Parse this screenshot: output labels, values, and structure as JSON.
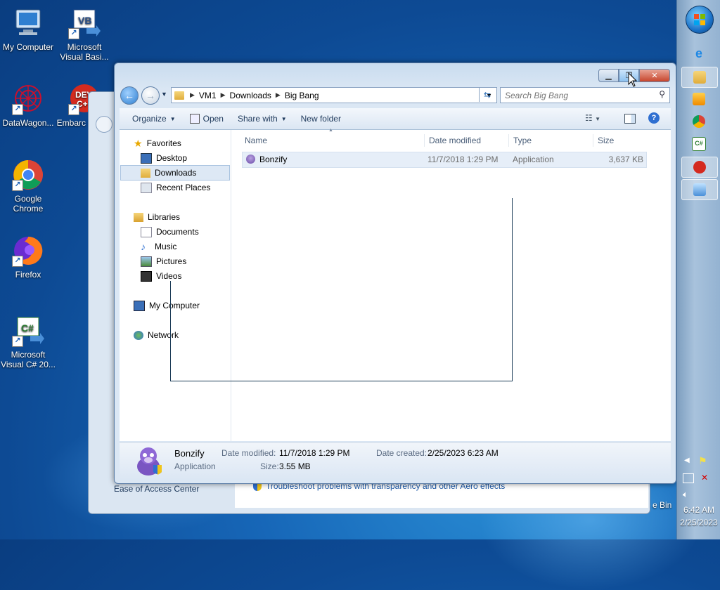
{
  "desktop": {
    "icons": [
      {
        "label": "My Computer"
      },
      {
        "label": "Microsoft Visual Basi..."
      },
      {
        "label": "DataWagon..."
      },
      {
        "label": "Embarc Dev-C"
      },
      {
        "label": "Google Chrome"
      },
      {
        "label": "Firefox"
      },
      {
        "label": "Microsoft Visual C# 20..."
      }
    ],
    "recycle_bin_partial": "e Bin"
  },
  "background_window": {
    "left_text": "Ease of Access Center",
    "link_text": "Troubleshoot problems with transparency and other Aero effects"
  },
  "explorer": {
    "address": {
      "crumbs": [
        "VM1",
        "Downloads",
        "Big Bang"
      ]
    },
    "search": {
      "placeholder": "Search Big Bang"
    },
    "toolbar": {
      "organize": "Organize",
      "open": "Open",
      "share_with": "Share with",
      "new_folder": "New folder"
    },
    "nav": {
      "favorites": "Favorites",
      "desktop": "Desktop",
      "downloads": "Downloads",
      "recent_places": "Recent Places",
      "libraries": "Libraries",
      "documents": "Documents",
      "music": "Music",
      "pictures": "Pictures",
      "videos": "Videos",
      "my_computer": "My Computer",
      "network": "Network"
    },
    "columns": {
      "name": "Name",
      "date_modified": "Date modified",
      "type": "Type",
      "size": "Size"
    },
    "files": [
      {
        "name": "Bonzify",
        "date_modified": "11/7/2018 1:29 PM",
        "type": "Application",
        "size": "3,637 KB"
      }
    ],
    "details": {
      "name": "Bonzify",
      "type": "Application",
      "date_modified_label": "Date modified:",
      "date_modified": "11/7/2018 1:29 PM",
      "date_created_label": "Date created:",
      "date_created": "2/25/2023 6:23 AM",
      "size_label": "Size:",
      "size": "3.55 MB"
    }
  },
  "taskbar": {
    "time": "6:42 AM",
    "date": "2/25/2023"
  },
  "colors": {
    "accent": "#1767b8",
    "taskbar": "#a8c2dc",
    "selection": "#dde8f5"
  }
}
